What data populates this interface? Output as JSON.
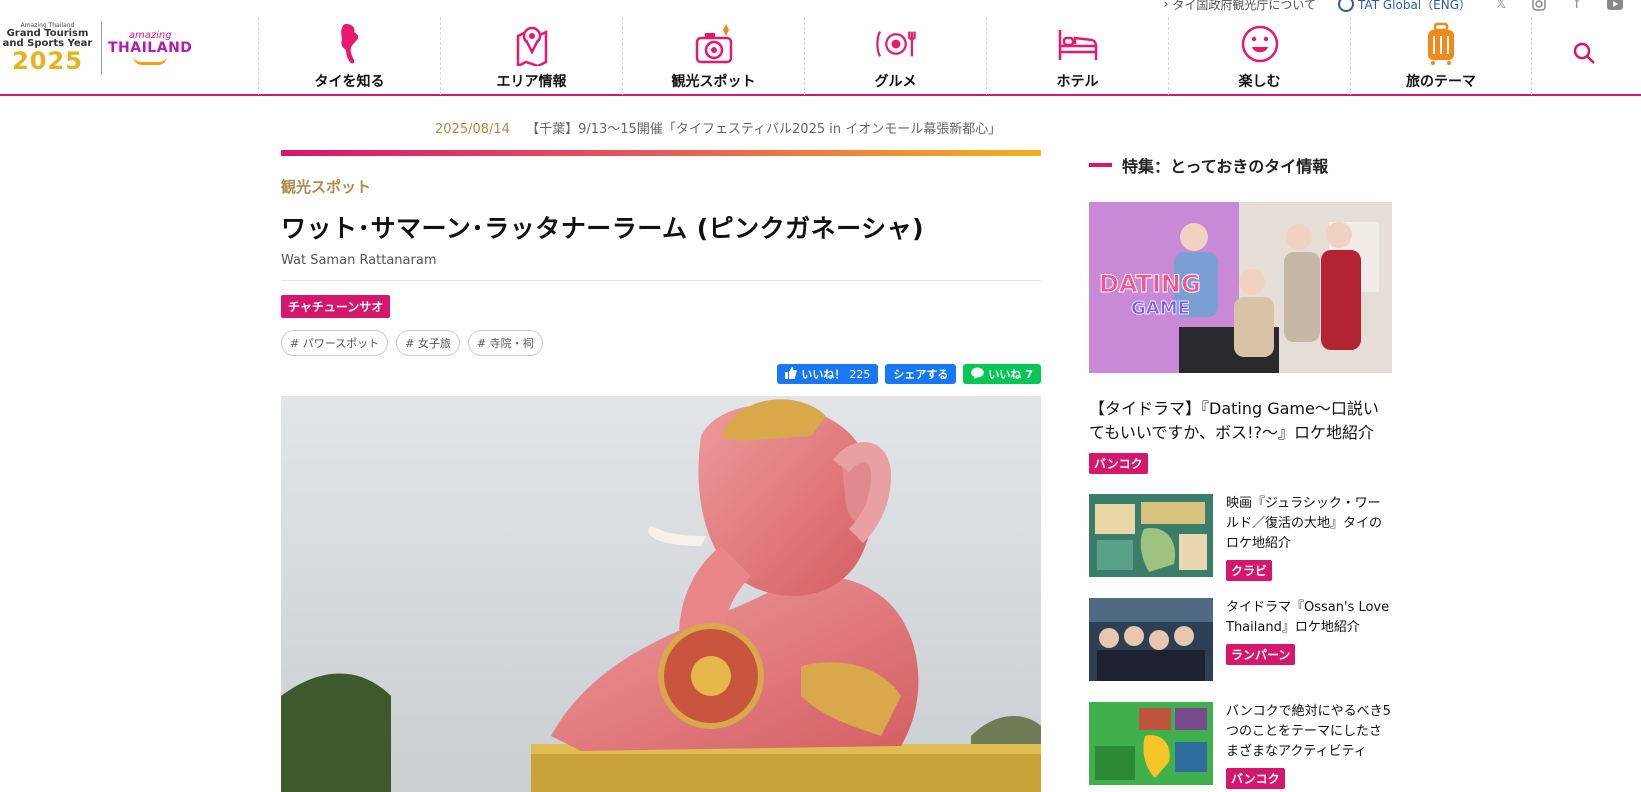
{
  "utility": {
    "about_link": "タイ国政府観光庁について",
    "global_link": "TAT Global（ENG）",
    "sns_icons": [
      "x-icon",
      "instagram-icon",
      "facebook-icon",
      "youtube-icon"
    ]
  },
  "logo": {
    "event_small": "Amazing Thailand",
    "event_line1": "Grand Tourism",
    "event_line2": "and Sports Year",
    "event_year": "2025",
    "brand_top": "amazing",
    "brand_main": "THAILAND"
  },
  "nav": {
    "items": [
      {
        "label": "タイを知る",
        "icon": "thailand-map-icon"
      },
      {
        "label": "エリア情報",
        "icon": "map-pin-icon"
      },
      {
        "label": "観光スポット",
        "icon": "camera-icon"
      },
      {
        "label": "グルメ",
        "icon": "dining-icon"
      },
      {
        "label": "ホテル",
        "icon": "bed-icon"
      },
      {
        "label": "楽しむ",
        "icon": "smile-icon"
      },
      {
        "label": "旅のテーマ",
        "icon": "suitcase-icon"
      }
    ]
  },
  "ticker": {
    "date": "2025/08/14",
    "text": "【千葉】9/13〜15開催「タイフェスティバル2025 in イオンモール幕張新都心」"
  },
  "article": {
    "category": "観光スポット",
    "title": "ワット･サマーン･ラッタナーラーム (ピンクガネーシャ)",
    "subtitle": "Wat Saman Rattanaram",
    "area_tag": "チャチューンサオ",
    "hashtags": [
      "# パワースポット",
      "# 女子旅",
      "# 寺院・祠"
    ],
    "social": {
      "fb_like": "いいね！",
      "fb_count": "225",
      "share": "シェアする",
      "line_like": "いいね",
      "line_count": "7"
    }
  },
  "sidebar": {
    "heading": "特集：とっておきのタイ情報",
    "feature": {
      "image_text": "DATING GAME",
      "title": "【タイドラマ】『Dating Game〜口説いてもいいですか、ボス!?〜』ロケ地紹介",
      "tag": "バンコク"
    },
    "items": [
      {
        "title": "映画『ジュラシック・ワールド／復活の大地』タイのロケ地紹介",
        "tag": "クラビ"
      },
      {
        "title": "タイドラマ『Ossan's Love Thailand』ロケ地紹介",
        "tag": "ランパーン"
      },
      {
        "title": "バンコクで絶対にやるべき5つのことをテーマにしたさまざまなアクティビティ",
        "tag": "バンコク"
      }
    ]
  },
  "colors": {
    "brand_pink": "#d4166c",
    "gold": "#b08a4a",
    "facebook": "#1877f2",
    "line": "#06c755"
  }
}
